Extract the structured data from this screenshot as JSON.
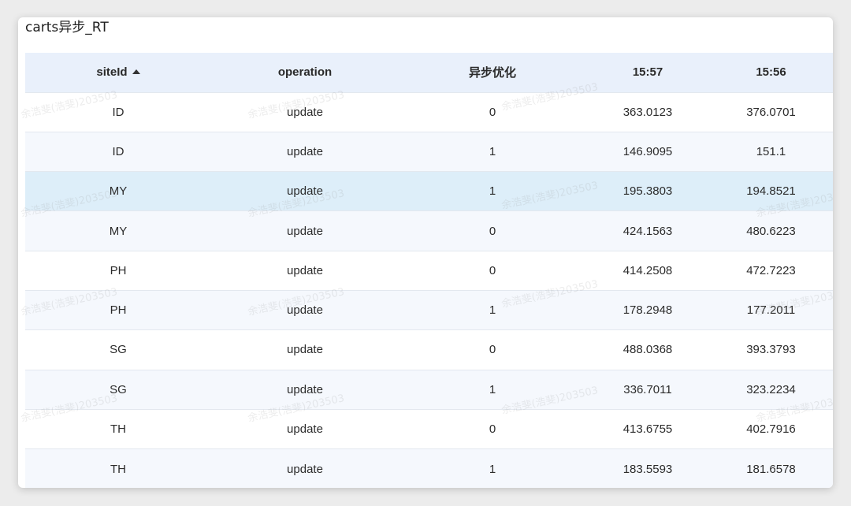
{
  "panel": {
    "title": "carts异步_RT"
  },
  "table": {
    "columns": [
      {
        "label": "siteId",
        "sorted": "ascending"
      },
      {
        "label": "operation"
      },
      {
        "label": "异步优化"
      },
      {
        "label": "15:57"
      },
      {
        "label": "15:56"
      }
    ],
    "rows": [
      [
        "ID",
        "update",
        "0",
        "363.0123",
        "376.0701"
      ],
      [
        "ID",
        "update",
        "1",
        "146.9095",
        "151.1"
      ],
      [
        "MY",
        "update",
        "1",
        "195.3803",
        "194.8521"
      ],
      [
        "MY",
        "update",
        "0",
        "424.1563",
        "480.6223"
      ],
      [
        "PH",
        "update",
        "0",
        "414.2508",
        "472.7223"
      ],
      [
        "PH",
        "update",
        "1",
        "178.2948",
        "177.2011"
      ],
      [
        "SG",
        "update",
        "0",
        "488.0368",
        "393.3793"
      ],
      [
        "SG",
        "update",
        "1",
        "336.7011",
        "323.2234"
      ],
      [
        "TH",
        "update",
        "0",
        "413.6755",
        "402.7916"
      ],
      [
        "TH",
        "update",
        "1",
        "183.5593",
        "181.6578"
      ]
    ],
    "hovered_row_index": 2
  },
  "watermark": {
    "text": "余浩斐(浩斐)203503"
  },
  "colors": {
    "header_bg": "#e9f0fb",
    "row_alt_bg": "#f5f8fd",
    "row_hover_bg": "#ddeef9"
  }
}
